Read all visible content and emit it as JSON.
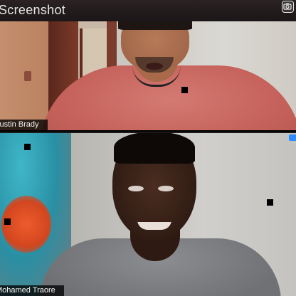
{
  "window": {
    "title": "Screenshot",
    "screenshot_icon": "camera-screenshot-icon"
  },
  "participants": [
    {
      "name": "Justin Brady"
    },
    {
      "name": "Mohamed Traore"
    }
  ],
  "colors": {
    "titlebar": "#1b1617",
    "active_badge": "#2d8cff"
  }
}
